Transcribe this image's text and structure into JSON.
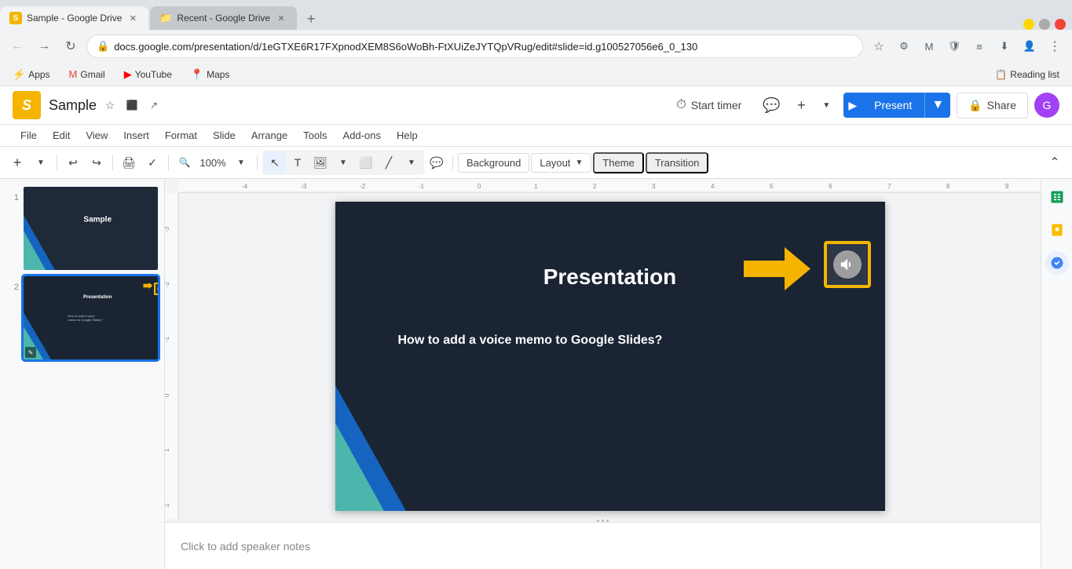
{
  "browser": {
    "tabs": [
      {
        "id": "tab1",
        "title": "Sample - Google Drive",
        "favicon": "🟧",
        "active": true
      },
      {
        "id": "tab2",
        "title": "Recent - Google Drive",
        "favicon": "📁",
        "active": false
      }
    ],
    "address": "docs.google.com/presentation/d/1eGTXE6R17FXpnodXEM8S6oWoBh-FtXUiZeJYTQpVRug/edit#slide=id.g100527056e6_0_130",
    "new_tab_label": "+",
    "bookmarks": [
      "Apps",
      "Gmail",
      "YouTube",
      "Maps"
    ],
    "reading_list_label": "Reading list"
  },
  "app": {
    "logo_letter": "S",
    "title": "Sample",
    "menu_items": [
      "File",
      "Edit",
      "View",
      "Insert",
      "Format",
      "Slide",
      "Arrange",
      "Tools",
      "Add-ons",
      "Help"
    ],
    "toolbar": {
      "zoom_level": "100%",
      "background_label": "Background",
      "layout_label": "Layout",
      "theme_label": "Theme",
      "transition_label": "Transition"
    },
    "header_actions": {
      "timer_label": "Start timer",
      "present_label": "Present",
      "share_label": "Share",
      "user_initial": "G"
    }
  },
  "slides": {
    "items": [
      {
        "num": "1",
        "label": "Slide 1 - title slide"
      },
      {
        "num": "2",
        "label": "Slide 2 - presentation slide",
        "selected": true
      }
    ]
  },
  "slide_content": {
    "title": "Presentation",
    "subtitle": "How to add a voice memo to Google Slides?",
    "annotation_arrow": "→",
    "speaker_icon": "🔊"
  },
  "notes": {
    "placeholder": "Click to add speaker notes"
  }
}
